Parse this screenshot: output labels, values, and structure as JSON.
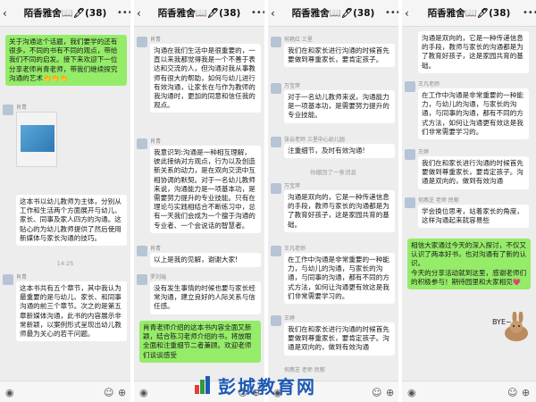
{
  "chat_title": "陌香雅舍📖🖊(38)",
  "panel1": {
    "msg_top": "关于沟通这个话题，我们要学的还有很多，不同的书有不同的观点，带给我们不同的启发。接下来欢迎下一位分享老师肖青老师，带我们继续探究沟通的艺术👏👏👏",
    "sender_a": "肖青",
    "msg_book": "这本书以幼儿教师为主体，分别从工作和生活两个方面展开与幼儿、家长、同事及家人四方的沟通。这贴心的为幼儿教师提供了然后使用新媒体与家长沟通的技巧。",
    "time": "14:25",
    "sender_b": "肖青",
    "msg_chapters": "这本书共有五个章节，其中我认为最重要的是与幼儿、家长、和同事沟通的前三个章节。次之的是第五章新媒体沟通，此书的内容展示非常新颖，以案例形式呈现出幼儿教师最为关心的若干问题。"
  },
  "panel2": {
    "sender_a": "肖青",
    "msg_a": "沟通在我们生活中是很重要的，一直以来我都觉得我是一个不善于表达和交流的人，但沟通对我从事教师有很大的帮助，如何与幼儿进行有效沟通，让家长在与作为教师的我沟通时，更加的同意和信任我的观点。",
    "sender_b": "肖青",
    "msg_b": "我意识到:沟通是一种相互理解，彼此接纳对方观点，行为以及创造新关系的动力，是在双向交流中互相协调的默契。对于一名幼儿教师来说，沟通能力是一项基本功，是需要努力提升的专业技能。只有在理论与实践相结合不断练习中，总有一天我们会成为一个擅于沟通的专业者、一个会说话的智慧者。",
    "sender_c": "肖青",
    "msg_c": "以上是我的见解，谢谢大家!",
    "sender_d": "罗刘瑞",
    "msg_d": "没有发生事情的时候也要与家长经常沟通，建立良好的人际关系与信任感。",
    "msg_e": "肖青老师介绍的这本书内容全面又新颖，结合陈习老师介绍的书，将放眼全面和注重细节二者兼顾。欢迎老师们谈谈感受"
  },
  "panel3": {
    "sender_a": "何艳红 三里",
    "msg_a": "我们在和家长进行沟通的时候首先要做到尊重家长，要肯定孩子。",
    "sender_b": "万宝萍",
    "msg_b": "对于一名幼儿教师来说，沟通能力是一项基本功，是需要努力提升的专业技能。",
    "sender_c": "张云老师 三里中心幼儿园",
    "msg_c": "注重细节，及时有效沟通!",
    "recall": "你撤回了一条消息",
    "sender_d": "万宝萍",
    "msg_d": "沟通是双向的，它是一种传递信息的手段，教师与家长的沟通都是为了教育好孩子，这是家园共育的基础。",
    "sender_e": "王凡老师",
    "msg_e": "在工作中沟通是非常重要的一种能力，与幼儿的沟通，与家长的沟通，与同事的沟通，都有不同的方式方法，如何让沟通更有效这是我们非常需要学习的。",
    "sender_f": "王婷",
    "msg_f": "我们在和家长进行沟通的时候首先要做到尊重家长，要肯定孩子。沟通是双向的，做到有效沟通",
    "sender_g": "何燕芝 老师 民郁"
  },
  "panel4": {
    "msg_a": "沟通是双向的，它是一种传递信息的手段，教师与家长的沟通都是为了教育好孩子，这是家园共育的基础。",
    "sender_b": "王凡老师",
    "msg_b": "在工作中沟通是非常重要的一种能力，与幼儿的沟通，与家长的沟通，与同事的沟通，都有不同的方式方法，如何让沟通更有效这是我们非常需要学习的。",
    "sender_c": "王婷",
    "msg_c": "我们在和家长进行沟通的时候首先要做到尊重家长，要肯定孩子。沟通是双向的，做到有效沟通",
    "sender_d": "何燕芝 老师 民郁",
    "msg_d": "学会换位思考，站着家长的角度，这样沟通起来就容易些",
    "msg_e": "相信大家通过今天的深入探讨，不仅又认识了两本好书，也对沟通有了新的认识。\n今天的分享活动就到这里，感谢老师们的积极参与！期待园里和大家相见💗",
    "sticker_text": "BYE~"
  },
  "watermark": "彭城教育网",
  "icons": {
    "back": "back-arrow-icon",
    "more": "more-icon",
    "voice": "voice-icon",
    "emoji": "emoji-icon",
    "plus": "plus-icon"
  }
}
